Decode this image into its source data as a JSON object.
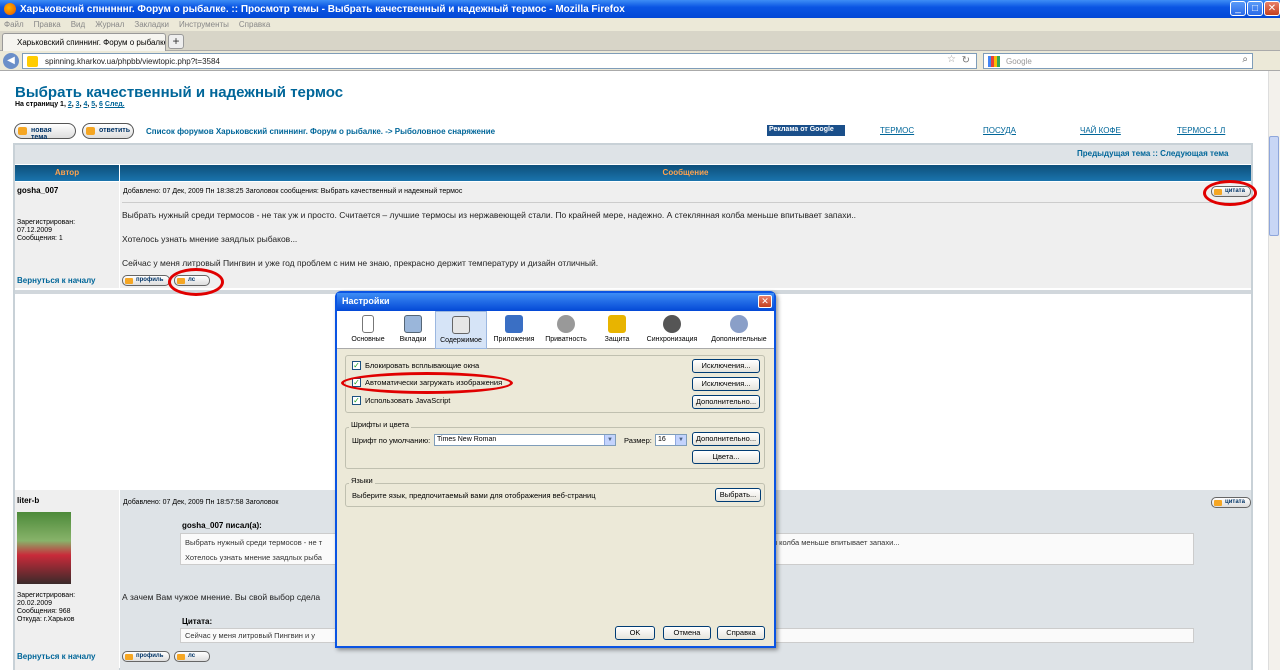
{
  "window": {
    "title": "Харьковскнй спнннннг. Форум о рыбалке. :: Просмотр темы - Выбрать качественный и надежный термос - Mozilla Firefox"
  },
  "menu": [
    "Файл",
    "Правка",
    "Вид",
    "Журнал",
    "Закладки",
    "Инструменты",
    "Справка"
  ],
  "tab": {
    "label": "Харьковский спиннинг. Форум о рыбалке..."
  },
  "nav": {
    "url": "spinning.kharkov.ua/phpbb/viewtopic.php?t=3584",
    "search_placeholder": "Google"
  },
  "page": {
    "title": "Выбрать качественный и надежный термос",
    "pager_prefix": "На страницу 1,",
    "pager_pages": [
      "2",
      "3",
      "4",
      "5",
      "6"
    ],
    "pager_next": "След.",
    "new_topic": "новая тема",
    "reply": "ответить",
    "breadcrumb": "Список форумов Харьковский спиннинг. Форум о рыбалке. -> Рыболовное снаряжение",
    "ad_label": "Реклама от Google",
    "ads": [
      "ТЕРМОС",
      "ПОСУДА",
      "ЧАЙ КОФЕ",
      "ТЕРМОС 1 Л"
    ],
    "topnav": "Предыдущая тема :: Следующая тема",
    "col_author": "Автор",
    "col_message": "Сообщение",
    "back_to_top": "Вернуться к началу",
    "profile_btn": "профиль",
    "pm_btn": "лс",
    "quote_btn": "цитата"
  },
  "posts": [
    {
      "author": "gosha_007",
      "meta": "Добавлено: 07 Дек, 2009 Пн 18:38:25     Заголовок сообщения: Выбрать качественный и надежный термос",
      "reg_label": "Зарегистрирован:",
      "reg_date": "07.12.2009",
      "msgs": "Сообщения: 1",
      "lines": [
        "Выбрать нужный среди термосов - не так уж и просто. Считается – лучшие термосы из нержавеющей стали. По крайней мере, надежно. А стеклянная колба меньше впитывает запахи..",
        "Хотелось узнать мнение заядлых рыбаков...",
        "Сейчас у меня литровый Пингвин и уже год проблем с ним не знаю, прекрасно держит температуру и дизайн отличный."
      ]
    },
    {
      "author": "liter-b",
      "meta": "Добавлено: 07 Дек, 2009 Пн 18:57:58     Заголовок",
      "reg_label": "Зарегистрирован:",
      "reg_date": "20.02.2009",
      "msgs": "Сообщения: 968",
      "from": "Откуда: г.Харьков",
      "quote_author": "gosha_007 писал(а):",
      "quote1": "Выбрать нужный среди термосов - не т",
      "quote1_tail": "я колба меньше впитывает запахи...",
      "quote2": "Хотелось узнать мнение заядлых рыба",
      "reply": "А зачем Вам чужое мнение. Вы свой выбор сдела",
      "cite_label": "Цитата:",
      "cite": "Сейчас у меня литровый Пингвин и у"
    }
  ],
  "dialog": {
    "title": "Настройки",
    "tabs": [
      "Основные",
      "Вкладки",
      "Содержимое",
      "Приложения",
      "Приватность",
      "Защита",
      "Синхронизация",
      "Дополнительные"
    ],
    "block_popups": "Блокировать всплывающие окна",
    "load_images": "Автоматически загружать изображения",
    "enable_js": "Использовать JavaScript",
    "exceptions": "Исключения...",
    "advanced": "Дополнительно...",
    "fonts_group": "Шрифты и цвета",
    "default_font_label": "Шрифт по умолчанию:",
    "default_font": "Times New Roman",
    "size_label": "Размер:",
    "size": "16",
    "colors": "Цвета...",
    "lang_group": "Языки",
    "lang_text": "Выберите язык, предпочитаемый вами для отображения веб-страниц",
    "choose": "Выбрать...",
    "ok": "OK",
    "cancel": "Отмена",
    "help": "Справка"
  }
}
